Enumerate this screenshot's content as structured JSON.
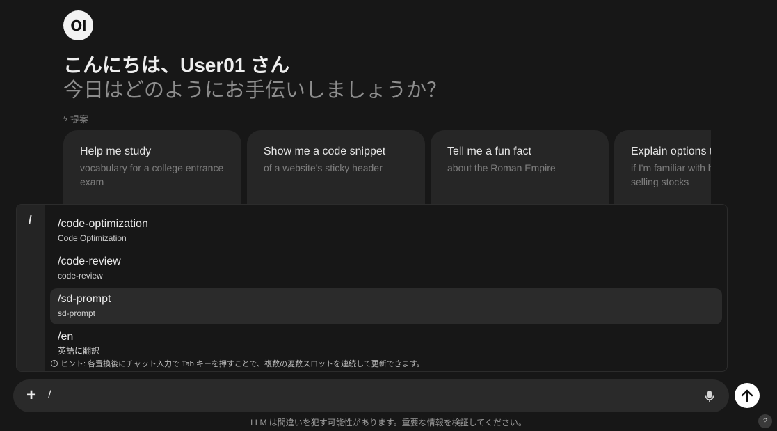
{
  "logo": {
    "text": "OI"
  },
  "greeting": "こんにちは、User01 さん",
  "subtitle": "今日はどのようにお手伝いしましょうか？",
  "suggestions": {
    "header": "提案",
    "cards": [
      {
        "title": "Help me study",
        "subtitle": "vocabulary for a college entrance exam"
      },
      {
        "title": "Show me a code snippet",
        "subtitle": "of a website's sticky header"
      },
      {
        "title": "Tell me a fun fact",
        "subtitle": "about the Roman Empire"
      },
      {
        "title": "Explain options trading",
        "subtitle": "if I'm familiar with buying and selling stocks"
      }
    ]
  },
  "commands": {
    "trigger": "/",
    "items": [
      {
        "name": "/code-optimization",
        "description": "Code Optimization"
      },
      {
        "name": "/code-review",
        "description": "code-review"
      },
      {
        "name": "/sd-prompt",
        "description": "sd-prompt"
      },
      {
        "name": "/en",
        "description": "英語に翻訳"
      }
    ],
    "active_index": 2,
    "hint": "ヒント: 各置換後にチャット入力で Tab キーを押すことで、複数の変数スロットを連続して更新できます。"
  },
  "chat": {
    "input_value": "/",
    "plus_label": "+"
  },
  "disclaimer": "LLM は間違いを犯す可能性があります。重要な情報を検証してください。",
  "help_label": "?"
}
